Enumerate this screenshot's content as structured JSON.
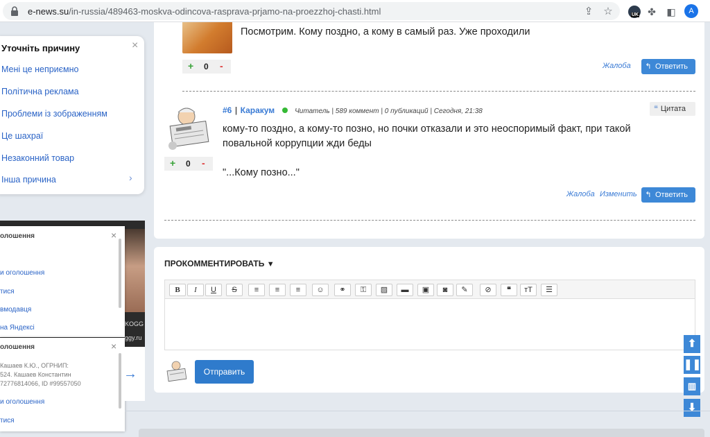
{
  "browser": {
    "url_host": "e-news.su",
    "url_path": "/in-russia/489463-moskva-odincova-rasprava-prjamo-na-proezzhoj-chasti.html",
    "profile_initial": "A",
    "ext_badge": "UK"
  },
  "reasons_popup": {
    "title": "Уточніть причину",
    "items": [
      "Мені це неприємно",
      "Політична реклама",
      "Проблеми із зображенням",
      "Це шахраї",
      "Незаконний товар",
      "Інша причина"
    ]
  },
  "ad_panel_1": {
    "title": "олошення",
    "links": [
      "и оголошення",
      "тися",
      "вмодавця",
      "на Яндексі"
    ]
  },
  "ad_panel_2": {
    "title": "олошення",
    "lines": [
      "Кашаев К.Ю., ОГРНИП:",
      "524. Кашаев Константин",
      "72776814066, ID #99557050"
    ],
    "links": [
      "и оголошення",
      "тися"
    ]
  },
  "ad_brand": "ggy.ru",
  "ad_brand2": "KOGG",
  "comment5": {
    "text": "Посмотрим. Кому поздно, а кому в самый раз. Уже проходили",
    "rating": "0",
    "complaint": "Жалоба",
    "reply": "Ответить"
  },
  "comment6": {
    "number": "#6",
    "separator": "|",
    "nick": "Каракум",
    "info": "Читатель | 589 коммент | 0 публикаций | Сегодня, 21:38",
    "quote_btn": "Цитата",
    "line1": "кому-то поздно, а кому-то позно, но почки отказали и это неоспоримый факт, при такой",
    "line2": "повальной коррупции жди беды",
    "line3": "\"...Кому позно...\"",
    "rating": "0",
    "complaint": "Жалоба",
    "edit": "Изменить",
    "reply": "Ответить"
  },
  "post_comment": {
    "title": "ПРОКОММЕНТИРОВАТЬ",
    "send": "Отправить"
  },
  "rating_plus": "+",
  "rating_minus": "-"
}
